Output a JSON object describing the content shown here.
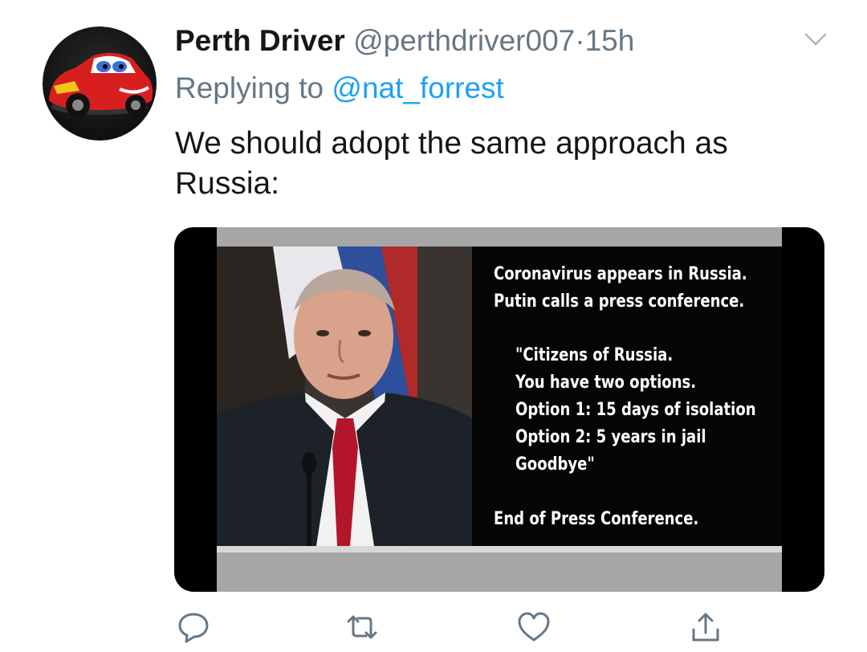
{
  "tweet": {
    "display_name": "Perth Driver",
    "handle": "@perthdriver007",
    "separator": "·",
    "time": "15h",
    "reply_prefix": "Replying to",
    "reply_to": "@nat_forrest",
    "text": "We should adopt the same approach as Russia:"
  },
  "media": {
    "lines": [
      "Coronavirus appears in Russia.",
      "Putin calls a press conference.",
      "\"Citizens of Russia.",
      "You have two options.",
      "Option 1: 15 days of isolation",
      "Option 2: 5 years in jail",
      "Goodbye\"",
      "End of Press Conference."
    ]
  },
  "icons": {
    "avatar": "cartoon-race-car-avatar",
    "menu": "chevron-down-icon",
    "reply": "reply-icon",
    "retweet": "retweet-icon",
    "like": "heart-icon",
    "share": "share-icon"
  },
  "colors": {
    "accent": "#1da1f2",
    "secondary_text": "#657786",
    "primary_text": "#14171a"
  }
}
